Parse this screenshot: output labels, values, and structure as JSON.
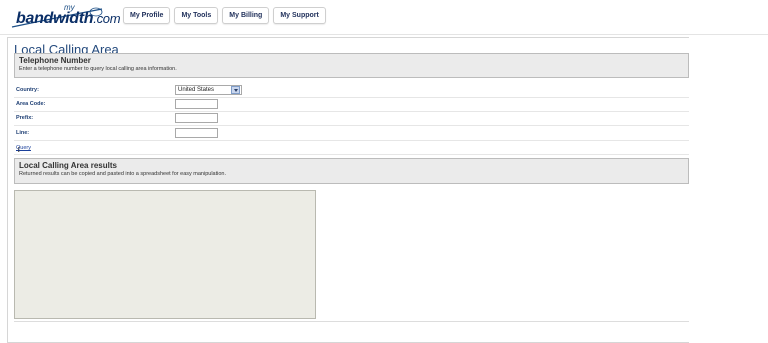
{
  "logo": {
    "prefix": "my",
    "brand": "bandwidth",
    "suffix": ".com"
  },
  "nav": [
    "My Profile",
    "My Tools",
    "My Billing",
    "My Support"
  ],
  "page": {
    "title": "Local Calling Area",
    "phone_section": {
      "heading": "Telephone Number",
      "description": "Enter a telephone number to query local calling area information."
    },
    "form": {
      "country_label": "Country:",
      "country_value": "United States",
      "area_code_label": "Area Code:",
      "area_code_value": "",
      "prefix_label": "Prefix:",
      "prefix_value": "",
      "line_label": "Line:",
      "line_value": ""
    },
    "query": {
      "open": "[ ",
      "link": "Query",
      "close": " ]"
    },
    "results_section": {
      "heading": "Local Calling Area results",
      "description": "Returned results can be copied and pasted into a spreadsheet for easy manipulation."
    },
    "results_value": ""
  }
}
